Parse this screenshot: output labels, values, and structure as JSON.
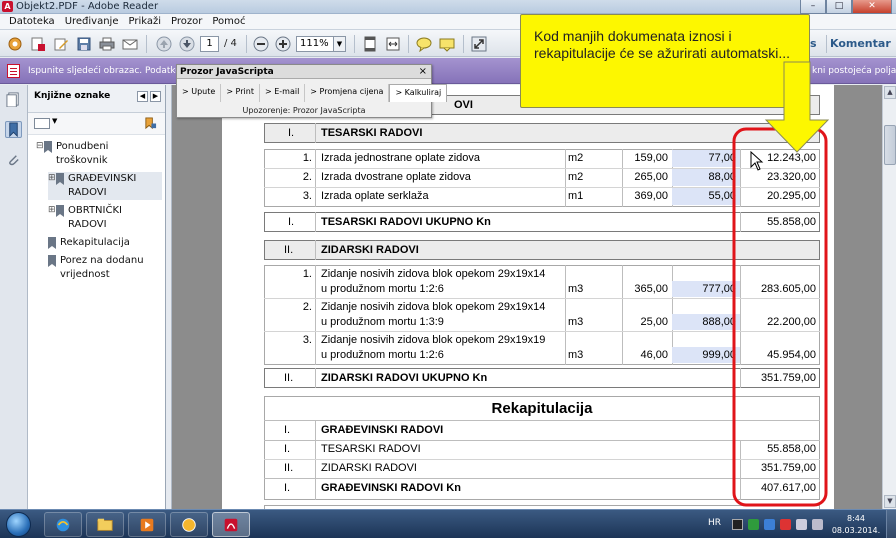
{
  "window": {
    "title": "Objekt2.PDF - Adobe Reader",
    "controls": [
      "–",
      "□",
      "✕"
    ]
  },
  "menubar": [
    "Datoteka",
    "Uređivanje",
    "Prikaži",
    "Prozor",
    "Pomoć"
  ],
  "toolbar": {
    "page_current": "1",
    "page_total": "/ 4",
    "zoom": "111%",
    "right_partial": "s",
    "comment_label": "Komentar"
  },
  "formbar": {
    "message": "Ispunite sljedeći obrazac. Podatke upisa",
    "message_right": "kni postojeća polja"
  },
  "js_dialog": {
    "title": "Prozor JavaScripta",
    "close": "×",
    "tabs": [
      "> Upute",
      "> Print",
      "> E-mail",
      "> Promjena cijena",
      "> Kalkuliraj"
    ],
    "warning": "Upozorenje: Prozor JavaScripta"
  },
  "bookmarks": {
    "title": "Knjižne oznake",
    "items": [
      {
        "label": "Ponudbeni troškovnik",
        "expander": "⊟"
      },
      {
        "label": "GRAĐEVINSKI RADOVI",
        "expander": "⊞"
      },
      {
        "label": "OBRTNIČKI RADOVI",
        "expander": "⊞"
      },
      {
        "label": "Rekapitulacija",
        "expander": ""
      },
      {
        "label": "Porez na dodanu vrijednost",
        "expander": ""
      }
    ]
  },
  "document": {
    "partial_header": "OVI",
    "sections": [
      {
        "number": "I.",
        "title": "TESARSKI RADOVI",
        "rows": [
          {
            "n": "1.",
            "desc": [
              "Izrada jednostrane oplate zidova"
            ],
            "unit": "m2",
            "qty": "159,00",
            "price": "77,00",
            "total": "12.243,00"
          },
          {
            "n": "2.",
            "desc": [
              "Izrada dvostrane oplate zidova"
            ],
            "unit": "m2",
            "qty": "265,00",
            "price": "88,00",
            "total": "23.320,00"
          },
          {
            "n": "3.",
            "desc": [
              "Izrada oplate serklaža"
            ],
            "unit": "m1",
            "qty": "369,00",
            "price": "55,00",
            "total": "20.295,00"
          }
        ],
        "total_label": "TESARSKI RADOVI UKUPNO Kn",
        "total_number": "I.",
        "total_value": "55.858,00"
      },
      {
        "number": "II.",
        "title": "ZIDARSKI RADOVI",
        "rows": [
          {
            "n": "1.",
            "desc": [
              "Zidanje nosivih zidova blok opekom 29x19x14",
              "u produžnom mortu 1:2:6"
            ],
            "unit": "m3",
            "qty": "365,00",
            "price": "777,00",
            "total": "283.605,00"
          },
          {
            "n": "2.",
            "desc": [
              "Zidanje nosivih zidova blok opekom 29x19x14",
              "u produžnom mortu 1:3:9"
            ],
            "unit": "m3",
            "qty": "25,00",
            "price": "888,00",
            "total": "22.200,00"
          },
          {
            "n": "3.",
            "desc": [
              "Zidanje nosivih zidova blok opekom 29x19x19",
              "u produžnom mortu 1:2:6"
            ],
            "unit": "m3",
            "qty": "46,00",
            "price": "999,00",
            "total": "45.954,00"
          }
        ],
        "total_label": "ZIDARSKI RADOVI UKUPNO Kn",
        "total_number": "II.",
        "total_value": "351.759,00"
      }
    ],
    "recap": {
      "title": "Rekapitulacija",
      "group_number": "I.",
      "group_title": "GRAĐEVINSKI RADOVI",
      "lines": [
        {
          "n": "I.",
          "label": "TESARSKI RADOVI",
          "value": "55.858,00"
        },
        {
          "n": "II.",
          "label": "ZIDARSKI RADOVI",
          "value": "351.759,00"
        }
      ],
      "total_number": "I.",
      "total_label": "GRAĐEVINSKI RADOVI Kn",
      "total_value": "407.617,00"
    }
  },
  "callout": {
    "text": "Kod manjih dokumenata iznosi i rekapitulacije će se ažurirati automatski...",
    "color": "#fdf700"
  },
  "annotation_color": "#e0141a",
  "taskbar": {
    "language": "HR",
    "time": "8:44",
    "date": "08.03.2014."
  }
}
